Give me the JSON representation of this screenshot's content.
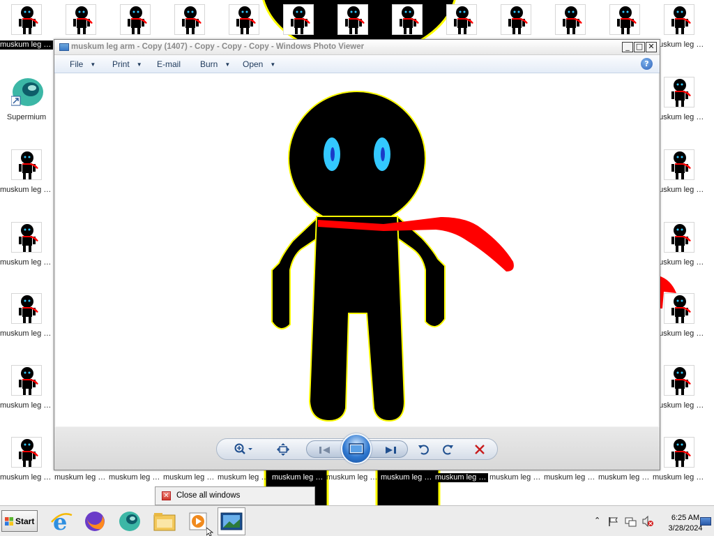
{
  "desktop": {
    "icon_label_a": "muskum leg arm - Copy...",
    "icon_label_selected": "muskum leg al arm - Copy...",
    "supermium_label": "Supermium"
  },
  "window": {
    "title": "muskum leg arm - Copy (1407) - Copy - Copy - Copy - Windows Photo Viewer",
    "menu": {
      "file": "File",
      "print": "Print",
      "email": "E-mail",
      "burn": "Burn",
      "open": "Open"
    },
    "help_glyph": "?",
    "minimize_glyph": "_",
    "maximize_glyph": "□",
    "close_glyph": "✕"
  },
  "image": {
    "figure_color": "#000000",
    "outline_color": "#ffff00",
    "eye_color": "#33c8ff",
    "scarf_color": "#ff0000"
  },
  "controls": {
    "zoom_icon": "zoom-icon",
    "actual_size_icon": "actual-size-icon",
    "previous_icon": "previous-icon",
    "slideshow_icon": "slideshow-icon",
    "next_icon": "next-icon",
    "rotate_ccw_icon": "rotate-counterclockwise-icon",
    "rotate_cw_icon": "rotate-clockwise-icon",
    "delete_icon": "delete-icon"
  },
  "jumplist": {
    "close_all": "Close all windows"
  },
  "taskbar": {
    "start": "Start",
    "time": "6:25 AM",
    "date": "3/28/2024"
  }
}
